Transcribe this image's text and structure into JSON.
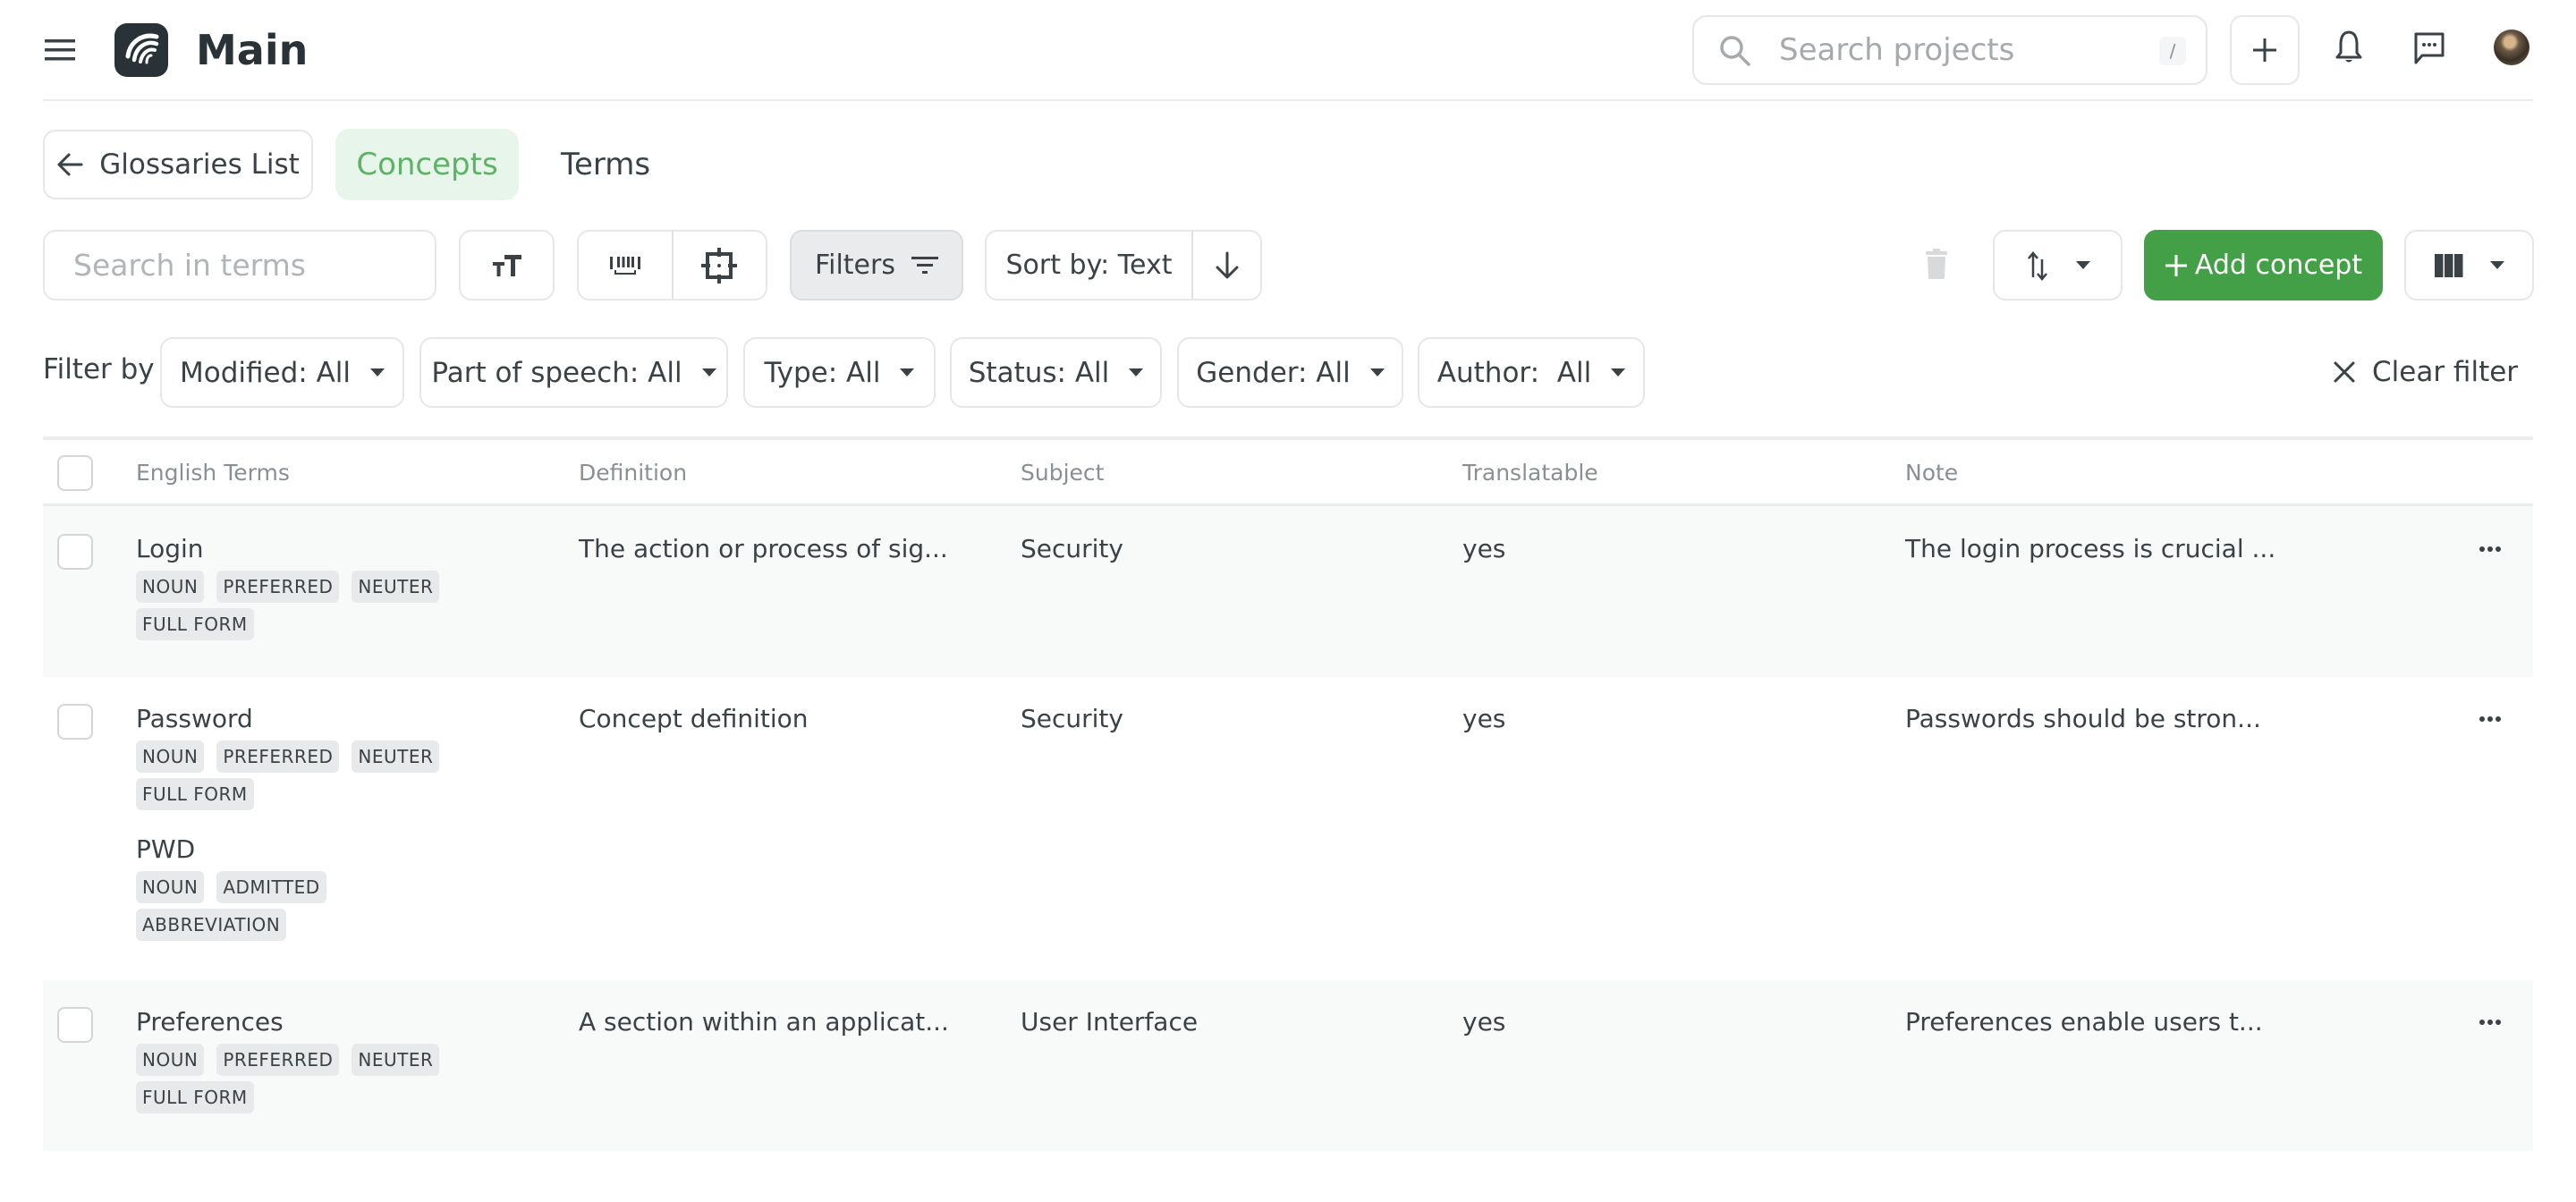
{
  "header": {
    "title": "Main",
    "search": {
      "placeholder": "Search projects",
      "shortcut": "/"
    },
    "icons": {
      "menu": "hamburger-icon",
      "logo": "app-logo",
      "add": "plus-icon",
      "notifications": "bell-icon",
      "messages": "chat-icon",
      "avatar": "user-avatar"
    }
  },
  "nav": {
    "back_label": "Glossaries List",
    "tabs": [
      {
        "label": "Concepts",
        "active": true
      },
      {
        "label": "Terms",
        "active": false
      }
    ]
  },
  "toolbar": {
    "search_placeholder": "Search in terms",
    "filters_label": "Filters",
    "sort_label": "Sort by: Text",
    "add_concept_label": "Add concept",
    "accent_color": "#43a047"
  },
  "filters": {
    "label": "Filter by",
    "dropdowns": [
      {
        "label": "Modified: All"
      },
      {
        "label": "Part of speech: All"
      },
      {
        "label": "Type: All"
      },
      {
        "label": "Status: All"
      },
      {
        "label": "Gender: All"
      },
      {
        "label": "Author:  All"
      }
    ],
    "clear_label": "Clear filter"
  },
  "table": {
    "columns": [
      "English Terms",
      "Definition",
      "Subject",
      "Translatable",
      "Note"
    ],
    "rows": [
      {
        "terms": [
          {
            "text": "Login",
            "tags": [
              "NOUN",
              "PREFERRED",
              "NEUTER",
              "FULL FORM"
            ]
          }
        ],
        "definition": "The action or process of sig...",
        "subject": "Security",
        "translatable": "yes",
        "note": "The login process is crucial ..."
      },
      {
        "terms": [
          {
            "text": "Password",
            "tags": [
              "NOUN",
              "PREFERRED",
              "NEUTER",
              "FULL FORM"
            ]
          },
          {
            "text": "PWD",
            "tags": [
              "NOUN",
              "ADMITTED",
              "ABBREVIATION"
            ]
          }
        ],
        "definition": "Concept definition",
        "subject": "Security",
        "translatable": "yes",
        "note": "Passwords should be stron..."
      },
      {
        "terms": [
          {
            "text": "Preferences",
            "tags": [
              "NOUN",
              "PREFERRED",
              "NEUTER",
              "FULL FORM"
            ]
          }
        ],
        "definition": "A section within an applicat...",
        "subject": "User Interface",
        "translatable": "yes",
        "note": "Preferences enable users t..."
      }
    ]
  }
}
